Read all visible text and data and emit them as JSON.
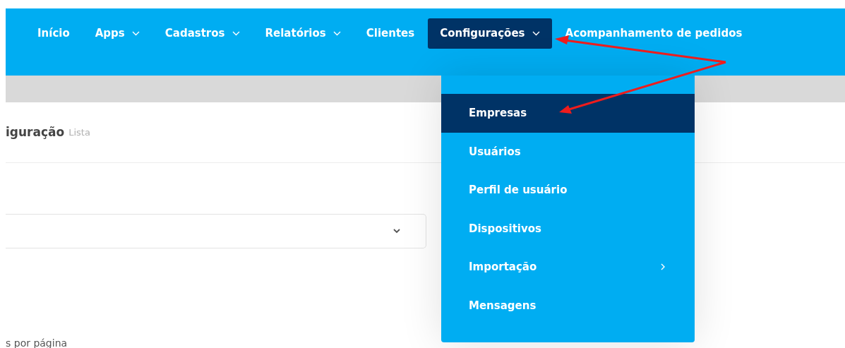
{
  "nav": [
    {
      "label": "Início",
      "dropdown": false,
      "selected": false
    },
    {
      "label": "Apps",
      "dropdown": true,
      "selected": false
    },
    {
      "label": "Cadastros",
      "dropdown": true,
      "selected": false
    },
    {
      "label": "Relatórios",
      "dropdown": true,
      "selected": false
    },
    {
      "label": "Clientes",
      "dropdown": false,
      "selected": false
    },
    {
      "label": "Configurações",
      "dropdown": true,
      "selected": true
    },
    {
      "label": "Acompanhamento de pedidos",
      "dropdown": false,
      "selected": false
    }
  ],
  "page_header": {
    "title": "iguração",
    "subtitle": "Lista"
  },
  "per_page_label": "s por página",
  "menu": [
    {
      "label": "Empresas",
      "selected": true,
      "submenu": false
    },
    {
      "label": "Usuários",
      "selected": false,
      "submenu": false
    },
    {
      "label": "Perfil de usuário",
      "selected": false,
      "submenu": false
    },
    {
      "label": "Dispositivos",
      "selected": false,
      "submenu": false
    },
    {
      "label": "Importação",
      "selected": false,
      "submenu": true
    },
    {
      "label": "Mensagens",
      "selected": false,
      "submenu": false
    }
  ]
}
